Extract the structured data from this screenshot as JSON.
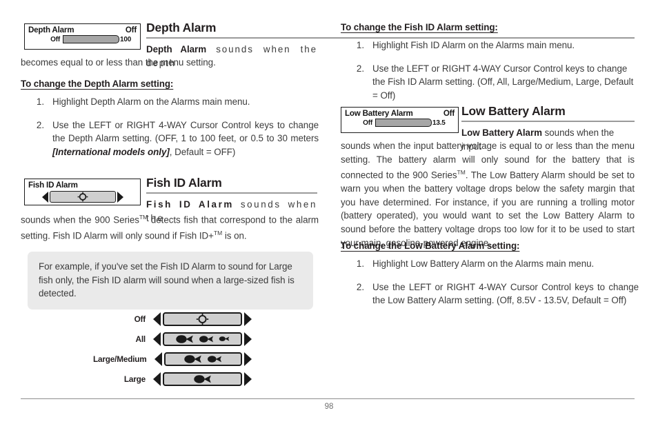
{
  "page": {
    "number": "98"
  },
  "depth_alarm": {
    "widget": {
      "title": "Depth Alarm",
      "value": "Off",
      "min_label": "Off",
      "max_label": "100"
    },
    "heading": "Depth Alarm",
    "intro_bold": "Depth Alarm",
    "intro_rest": " sounds when the depth becomes equal to or less than the menu setting.",
    "subhead": "To change the Depth Alarm setting:",
    "steps": [
      {
        "num": "1.",
        "text": "Highlight Depth Alarm on the Alarms main menu."
      },
      {
        "num": "2.",
        "text_a": "Use the LEFT or RIGHT 4-WAY Cursor Control keys to change the Depth Alarm setting. (OFF, 1 to 100 feet, or 0.5 to 30 meters ",
        "text_italic": "[International models only]",
        "text_b": ", Default = OFF)"
      }
    ]
  },
  "fish_id_alarm": {
    "widget": {
      "title": "Fish ID Alarm",
      "value_icon": "fish-off-circle-icon"
    },
    "heading": "Fish ID Alarm",
    "intro_bold": "Fish ID Alarm",
    "intro_rest_a": " sounds when the 900 Series",
    "intro_tm1": "TM",
    "intro_rest_b": " detects fish that correspond to the alarm setting. Fish ID Alarm will only sound if Fish ID+",
    "intro_tm2": "TM",
    "intro_rest_c": " is on."
  },
  "callout": {
    "text": "For example, if you've set the Fish ID Alarm to sound for Large fish only, the Fish ID alarm will sound when a large-sized fish is detected."
  },
  "fish_chart": {
    "rows": [
      {
        "label": "Off",
        "icons": [
          "circle-off-icon"
        ]
      },
      {
        "label": "All",
        "icons": [
          "fish-large-icon",
          "fish-medium-icon",
          "fish-small-icon"
        ]
      },
      {
        "label": "Large/Medium",
        "icons": [
          "fish-large-icon",
          "fish-medium-icon"
        ]
      },
      {
        "label": "Large",
        "icons": [
          "fish-large-icon"
        ]
      }
    ]
  },
  "fish_id_procedure": {
    "subhead": "To change the Fish ID Alarm setting:",
    "steps": [
      {
        "num": "1.",
        "text": "Highlight Fish ID Alarm on the Alarms main menu."
      },
      {
        "num": "2.",
        "text": "Use the LEFT or RIGHT 4-WAY Cursor Control keys to change the Fish ID Alarm setting. (Off, All, Large/Medium, Large, Default = Off)"
      }
    ]
  },
  "low_battery_alarm": {
    "widget": {
      "title": "Low Battery Alarm",
      "value": "Off",
      "min_label": "Off",
      "max_label": "13.5"
    },
    "heading": "Low Battery Alarm",
    "intro_bold": "Low Battery Alarm",
    "intro_rest_a": " sounds when the input battery voltage is equal to or less than the menu setting. The battery alarm will only sound for the battery that is connected to the 900 Series",
    "intro_tm": "TM",
    "intro_rest_b": ". The Low Battery Alarm should be set to warn you when the battery voltage drops below the safety margin that you have determined. For instance, if you are running a trolling motor (battery operated), you would want to set the Low Battery Alarm to sound before the battery voltage drops too low for it to be used to start your main, gasoline-powered engine.",
    "subhead": "To change the Low Battery Alarm setting:",
    "steps": [
      {
        "num": "1.",
        "text": "Highlight Low Battery Alarm on the Alarms main menu."
      },
      {
        "num": "2.",
        "text": "Use the LEFT or RIGHT 4-WAY Cursor Control keys to change the Low Battery Alarm setting. (Off, 8.5V - 13.5V, Default = Off)"
      }
    ]
  },
  "colors": {
    "text": "#3b3b3b",
    "heading": "#231f20",
    "rule": "#9a9a9a",
    "lcd_fill": "#a6a6a6",
    "lcd_field": "#cfcfcf",
    "callout_bg": "#eaeaea"
  }
}
